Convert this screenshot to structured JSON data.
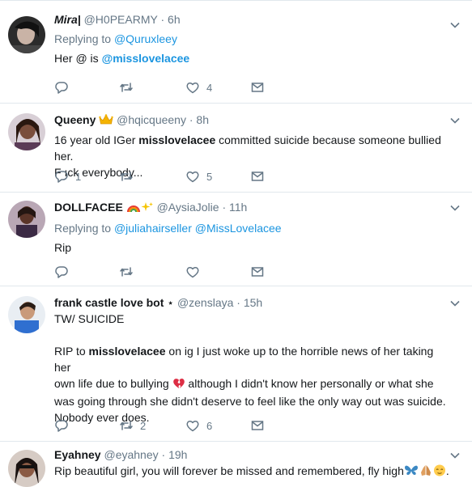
{
  "tweets": [
    {
      "name": "Mira|",
      "handle": "@H0PEARMY",
      "time": "6h",
      "reply_prefix": "Replying to ",
      "reply_to": "@Quruxleey",
      "text_pre": "Her @ is ",
      "text_mention": "@misslovelacee",
      "counts": {
        "reply": "",
        "retweet": "",
        "like": "4"
      }
    },
    {
      "name": "Queeny",
      "handle": "@hqicqueeny",
      "time": "8h",
      "text_pre": "16 year old IGer ",
      "text_bold": "misslovelacee",
      "text_post": " committed suicide because someone bullied her.",
      "text_line2": "F ıck everybody...",
      "counts": {
        "reply": "1",
        "retweet": "",
        "like": "5"
      }
    },
    {
      "name": "DOLLFACEE",
      "handle": "@AysiaJolie",
      "time": "11h",
      "reply_prefix": "Replying to ",
      "reply_to_1": "@juliahairseller",
      "reply_to_2": "@MissLovelacee",
      "text": "Rip",
      "counts": {
        "reply": "",
        "retweet": "",
        "like": ""
      }
    },
    {
      "name": "frank castle love bot",
      "star": "⋆",
      "handle": "@zenslaya",
      "time": "15h",
      "line1": "TW/ SUICIDE",
      "p_pre": "RIP to ",
      "p_bold": "misslovelacee",
      "p_post1": " on ig I just woke up to the horrible news of her taking her",
      "p_line2a": "own life due to bullying ",
      "p_line2b": " although I didn't know her personally or what she",
      "p_line3": "was going through she didn't deserve to feel like the only way out was suicide.",
      "p_line4": "Nobody ever does.",
      "counts": {
        "reply": "",
        "retweet": "2",
        "like": "6"
      }
    },
    {
      "name": "Eyahney",
      "handle": "@eyahney",
      "time": "19h",
      "text": "Rip beautiful girl, you will forever be missed and remembered, fly high",
      "text_end": "."
    }
  ],
  "separator": "·",
  "icons": [
    "reply-icon",
    "retweet-icon",
    "like-icon",
    "message-icon",
    "chevron-down-icon",
    "crown-emoji",
    "rainbow-emoji",
    "sparkles-emoji",
    "broken-heart-emoji",
    "butterfly-emoji",
    "praying-hands-emoji",
    "relieved-face-emoji"
  ],
  "colors": {
    "link": "#1b95e0",
    "muted": "#657786",
    "text": "#14171a",
    "border": "#e1e8ed"
  }
}
